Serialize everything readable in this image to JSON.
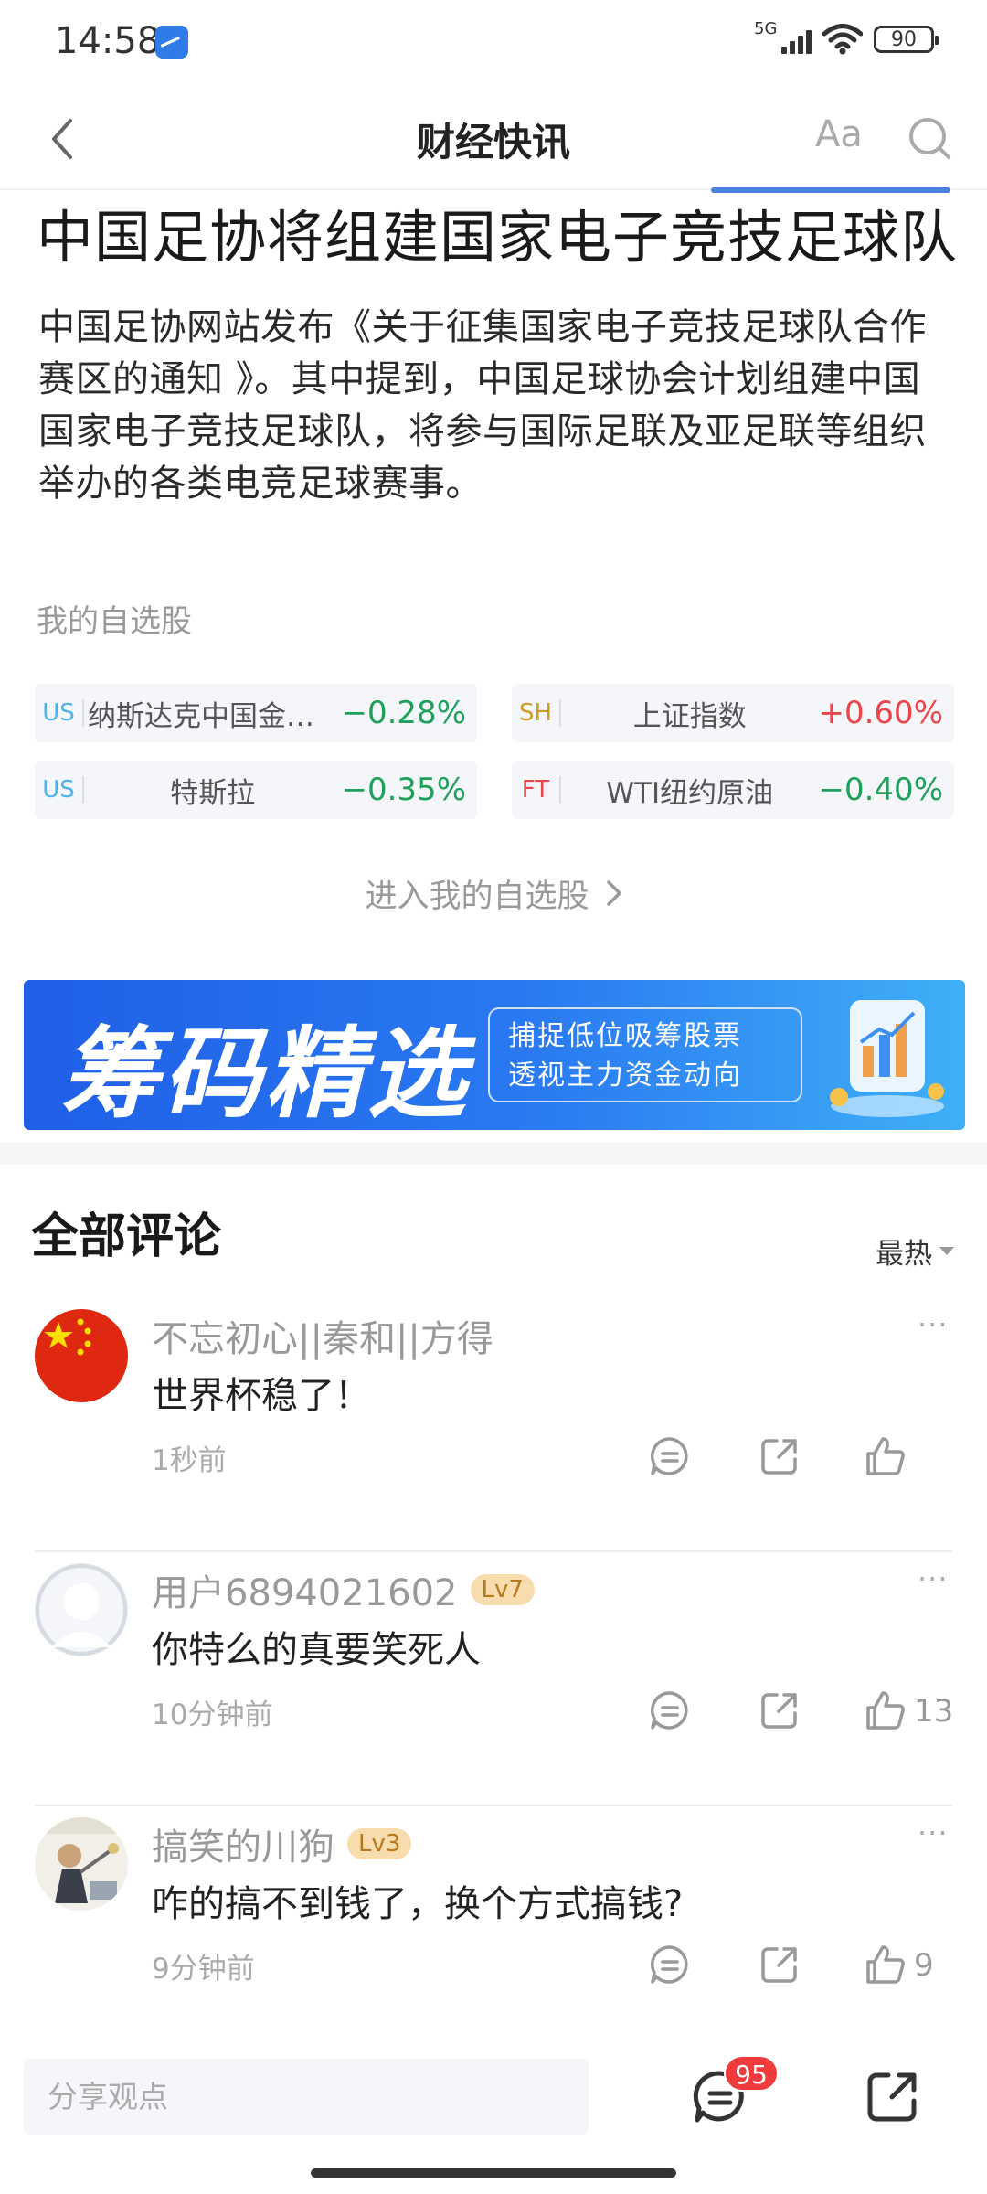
{
  "status_bar": {
    "time": "14:58",
    "network": "5G",
    "battery": "90"
  },
  "nav": {
    "title": "财经快讯",
    "font_size_label": "Aa"
  },
  "article": {
    "headline": "中国足协将组建国家电子竞技足球队",
    "body": "中国足协网站发布《关于征集国家电子竞技足球队合作赛区的通知 》。其中提到，中国足球协会计划组建中国国家电子竞技足球队，将参与国际足联及亚足联等组织举办的各类电竞足球赛事。"
  },
  "watchlist": {
    "title": "我的自选股",
    "stocks": [
      {
        "market": "US",
        "name": "纳斯达克中国金龙…",
        "change": "−0.28%",
        "direction": "down"
      },
      {
        "market": "SH",
        "name": "上证指数",
        "change": "+0.60%",
        "direction": "up"
      },
      {
        "market": "US",
        "name": "特斯拉",
        "change": "−0.35%",
        "direction": "down"
      },
      {
        "market": "FT",
        "name": "WTI纽约原油",
        "change": "−0.40%",
        "direction": "down"
      }
    ],
    "enter_label": "进入我的自选股"
  },
  "banner": {
    "title": "筹码精选",
    "line1": "捕捉低位吸筹股票",
    "line2": "透视主力资金动向"
  },
  "comments": {
    "title": "全部评论",
    "sort_label": "最热",
    "items": [
      {
        "user": "不忘初心||秦和||方得",
        "level": "",
        "text": "世界杯稳了！",
        "time": "1秒前",
        "likes": ""
      },
      {
        "user": "用户6894021602",
        "level": "Lv7",
        "text": "你特么的真要笑死人",
        "time": "10分钟前",
        "likes": "13"
      },
      {
        "user": "搞笑的川狗",
        "level": "Lv3",
        "text": "咋的搞不到钱了，换个方式搞钱?",
        "time": "9分钟前",
        "likes": "9"
      }
    ],
    "more_label": "···"
  },
  "bottom_bar": {
    "input_placeholder": "分享观点",
    "comment_count": "95"
  },
  "colors": {
    "up": "#e9464b",
    "down": "#1fa05a",
    "accent": "#2a7af2",
    "badge": "#ef3b3b"
  }
}
